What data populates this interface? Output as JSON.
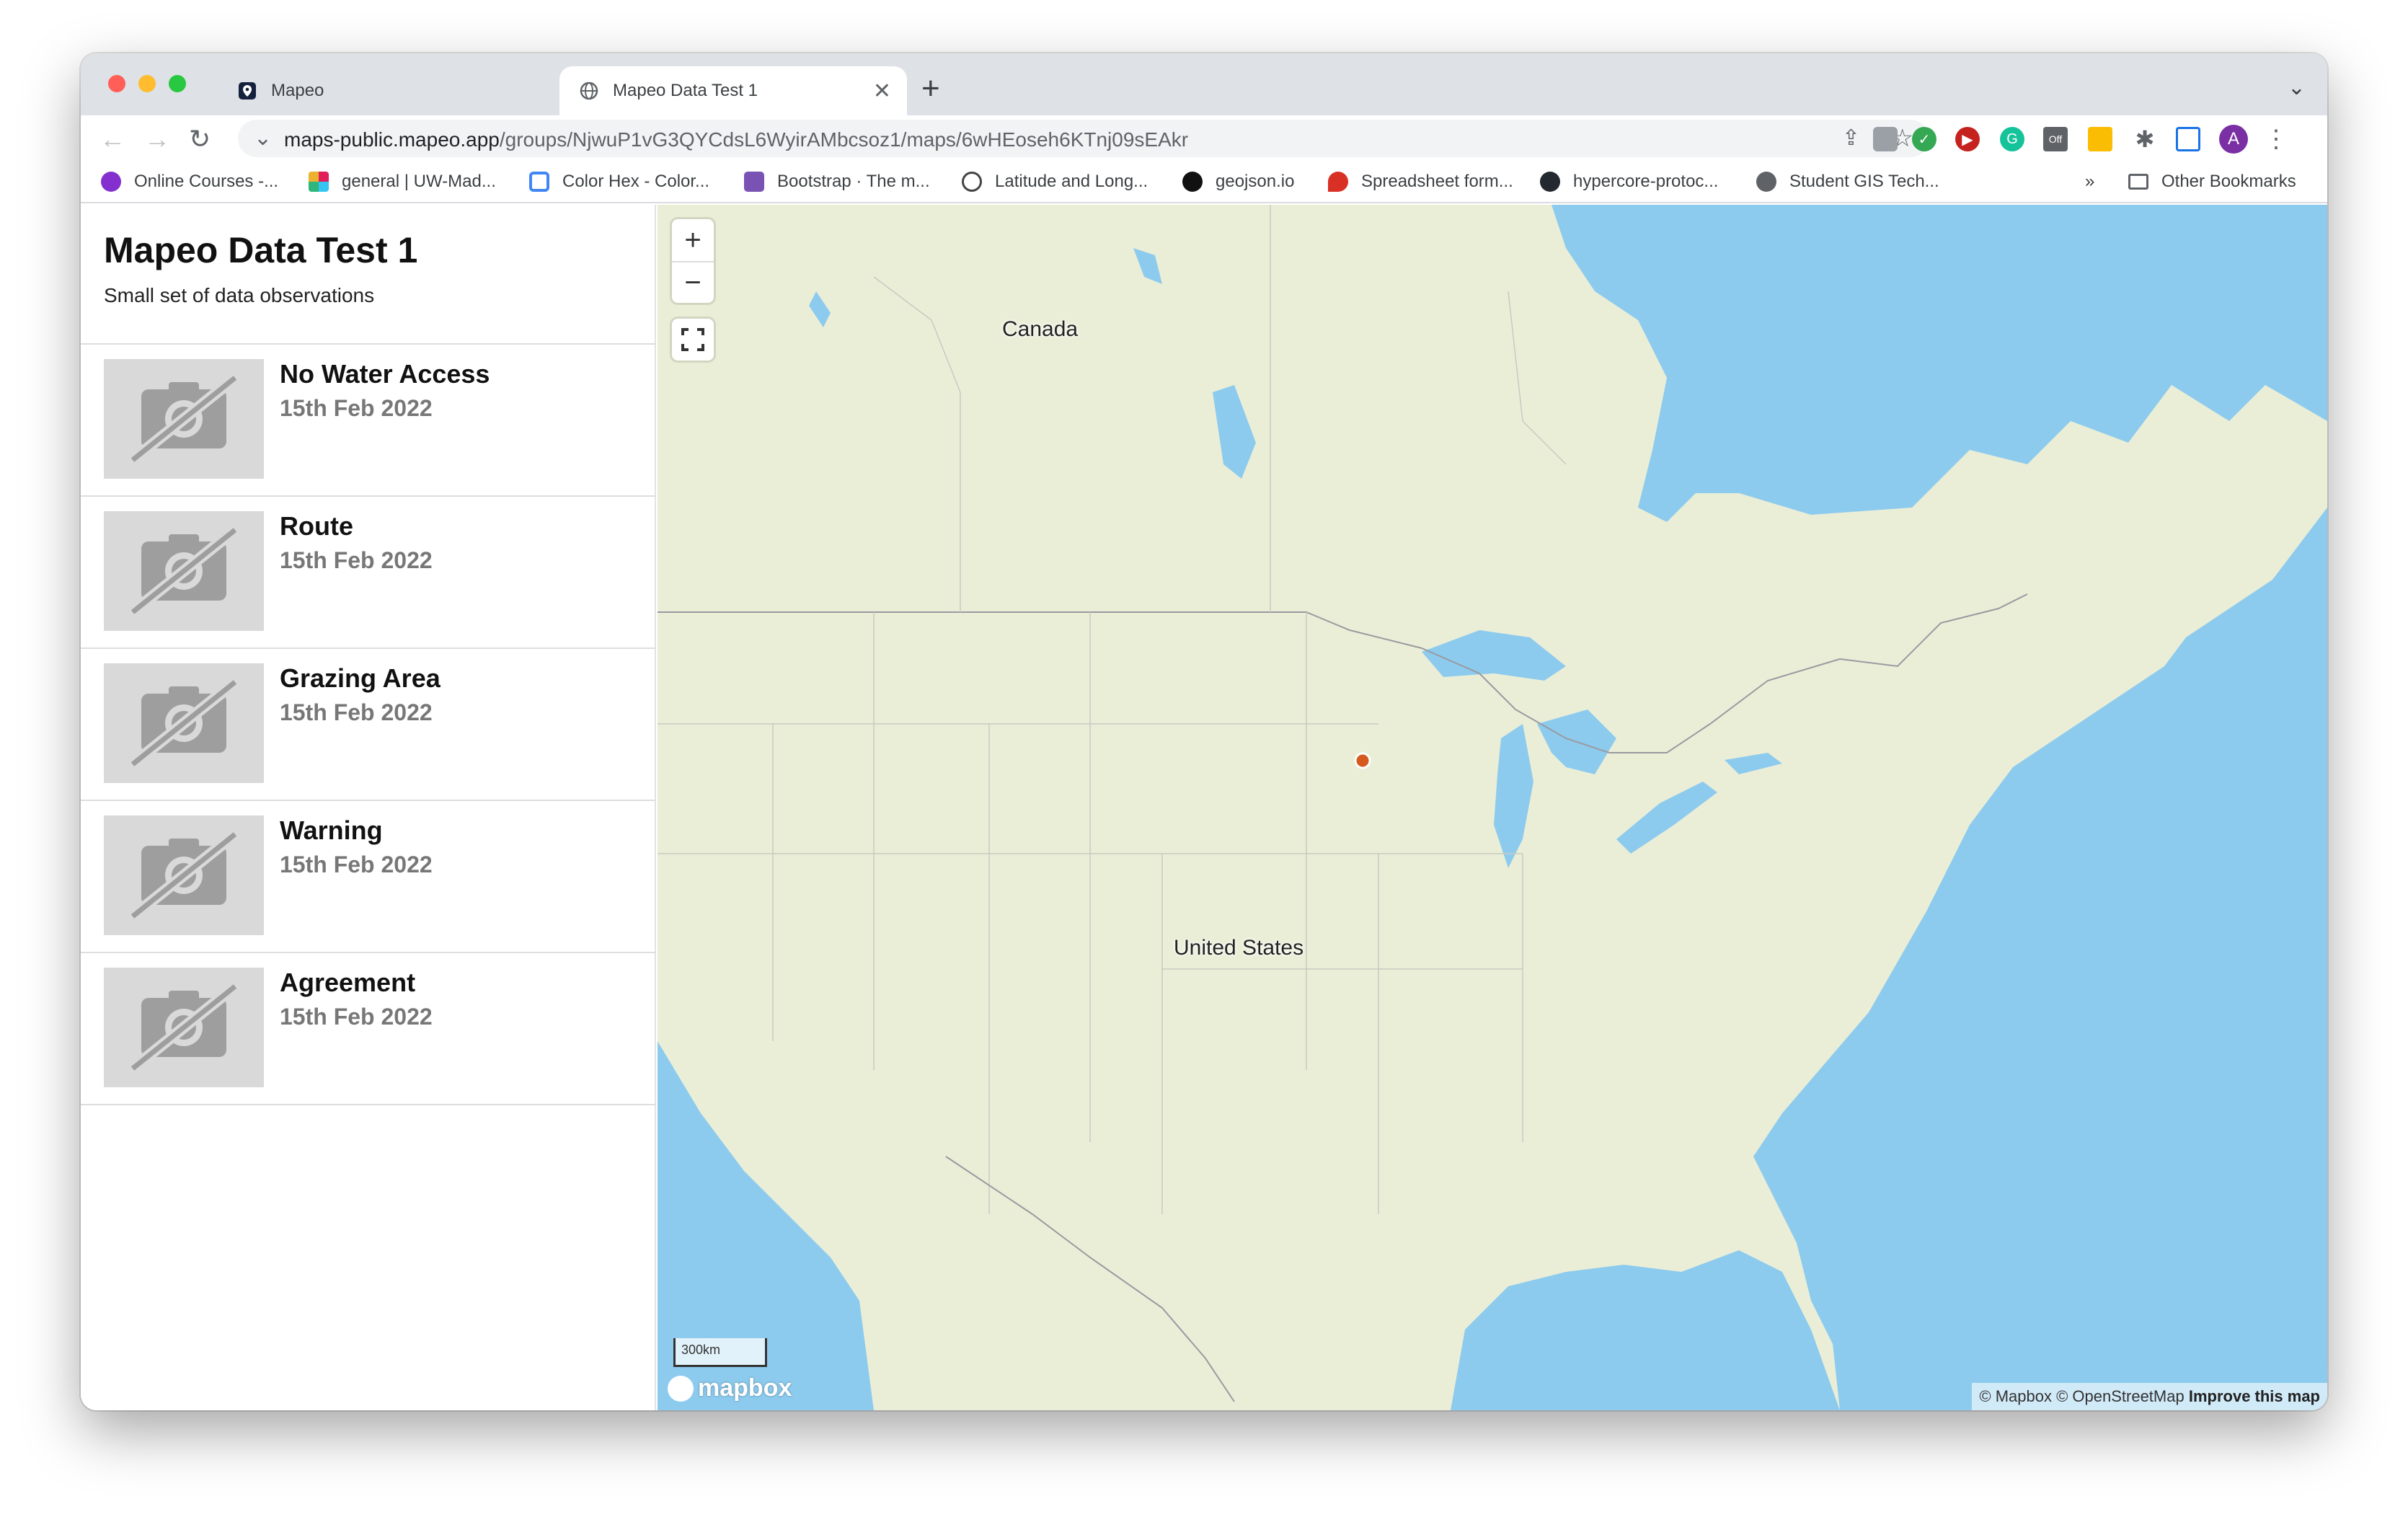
{
  "browser": {
    "tabs": [
      {
        "title": "Mapeo",
        "active": false
      },
      {
        "title": "Mapeo Data Test 1",
        "active": true
      }
    ],
    "url_host": "maps-public.mapeo.app",
    "url_path": "/groups/NjwuP1vG3QYCdsL6WyirAMbcsoz1/maps/6wHEoseh6KTnj09sEAkr",
    "profile_initial": "A",
    "extension_badge": "Off",
    "bookmarks": [
      "Online Courses -...",
      "general | UW-Mad...",
      "Color Hex - Color...",
      "Bootstrap · The m...",
      "Latitude and Long...",
      "geojson.io",
      "Spreadsheet form...",
      "hypercore-protoc...",
      "Student GIS Tech..."
    ],
    "bookmarks_overflow": "»",
    "other_bookmarks": "Other Bookmarks"
  },
  "sidebar": {
    "title": "Mapeo Data Test 1",
    "subtitle": "Small set of data observations",
    "items": [
      {
        "name": "No Water Access",
        "date": "15th Feb 2022"
      },
      {
        "name": "Route",
        "date": "15th Feb 2022"
      },
      {
        "name": "Grazing Area",
        "date": "15th Feb 2022"
      },
      {
        "name": "Warning",
        "date": "15th Feb 2022"
      },
      {
        "name": "Agreement",
        "date": "15th Feb 2022"
      }
    ]
  },
  "map": {
    "labels": {
      "canada": "Canada",
      "usa": "United States"
    },
    "zoom_in": "+",
    "zoom_out": "−",
    "scale": "300km",
    "logo": "mapbox",
    "attribution": "© Mapbox © OpenStreetMap",
    "improve": "Improve this map",
    "colors": {
      "land": "#ebeed7",
      "water": "#8dcbee",
      "marker": "#d65a1e"
    }
  }
}
